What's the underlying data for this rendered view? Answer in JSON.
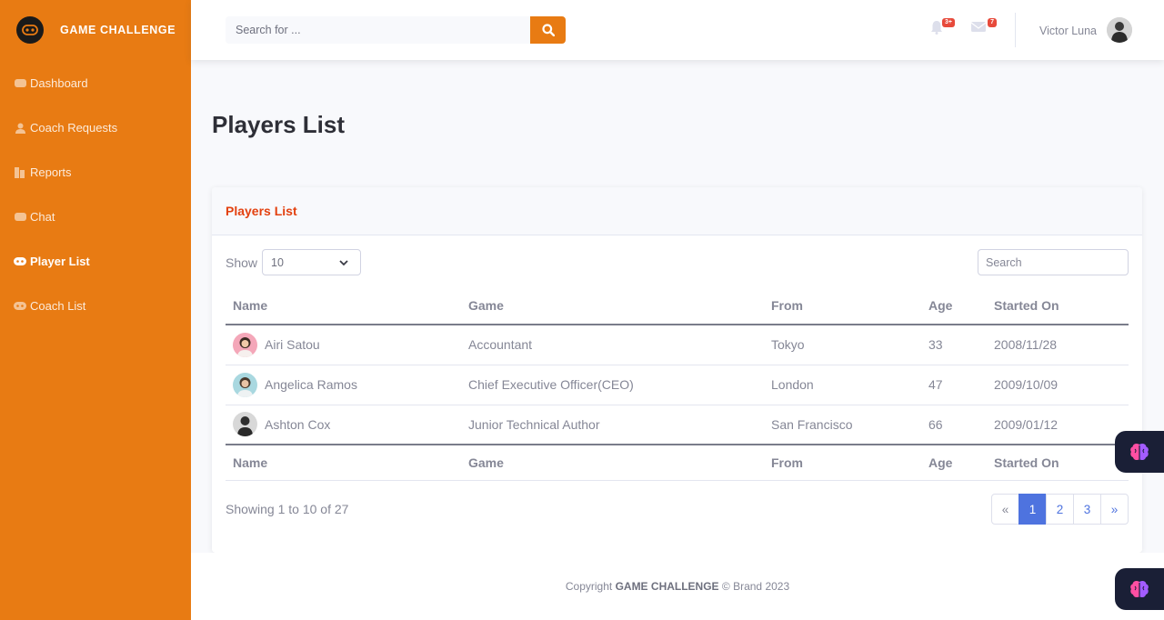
{
  "brand": {
    "name": "GAME CHALLENGE"
  },
  "sidebar": {
    "items": [
      {
        "label": "Dashboard",
        "icon": "dashboard-icon",
        "active": false
      },
      {
        "label": "Coach Requests",
        "icon": "user-icon",
        "active": false
      },
      {
        "label": "Reports",
        "icon": "reports-icon",
        "active": false
      },
      {
        "label": "Chat",
        "icon": "chat-icon",
        "active": false
      },
      {
        "label": "Player List",
        "icon": "gamepad-icon",
        "active": true
      },
      {
        "label": "Coach List",
        "icon": "gamepad-icon",
        "active": false
      }
    ]
  },
  "topbar": {
    "search_placeholder": "Search for ...",
    "alerts_badge": "3+",
    "messages_badge": "7",
    "user_name": "Victor Luna"
  },
  "page": {
    "title": "Players List"
  },
  "card": {
    "title": "Players List",
    "show_label": "Show",
    "show_value": "10",
    "search_placeholder": "Search",
    "columns": [
      "Name",
      "Game",
      "From",
      "Age",
      "Started On"
    ],
    "rows": [
      {
        "name": "Airi Satou",
        "game": "Accountant",
        "from": "Tokyo",
        "age": "33",
        "started": "2008/11/28"
      },
      {
        "name": "Angelica Ramos",
        "game": "Chief Executive Officer(CEO)",
        "from": "London",
        "age": "47",
        "started": "2009/10/09"
      },
      {
        "name": "Ashton Cox",
        "game": "Junior Technical Author",
        "from": "San Francisco",
        "age": "66",
        "started": "2009/01/12"
      }
    ],
    "info": "Showing 1 to 10 of 27",
    "pagination": {
      "prev": "«",
      "pages": [
        "1",
        "2",
        "3"
      ],
      "next": "»",
      "active": "1"
    }
  },
  "footer": {
    "prefix": "Copyright",
    "brand": "GAME CHALLENGE",
    "suffix": "© Brand 2023"
  },
  "colors": {
    "sidebar": "#e87b13",
    "accent": "#e87b13",
    "card_title": "#e3410f",
    "page_active": "#4e73df",
    "badge": "#e74a3b"
  }
}
